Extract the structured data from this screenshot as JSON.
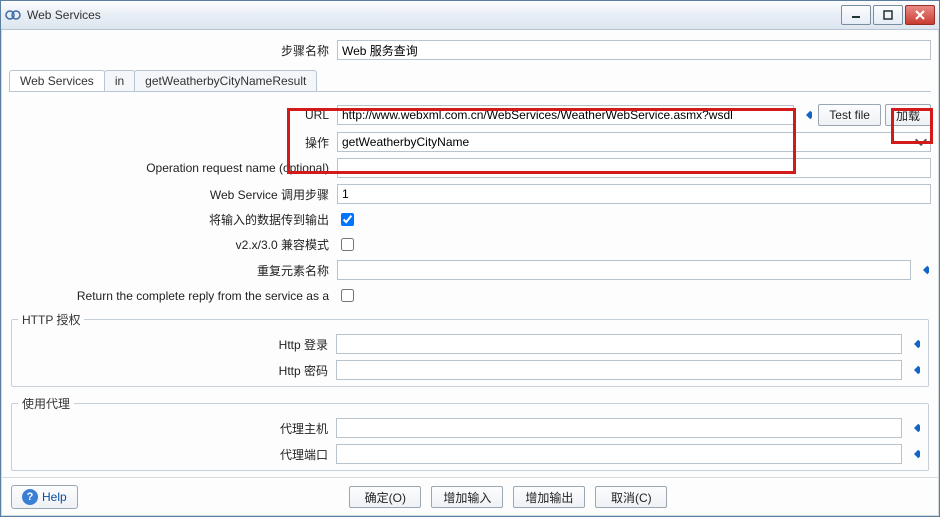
{
  "window": {
    "title": "Web Services",
    "min_tooltip": "Minimize",
    "max_tooltip": "Maximize",
    "close_tooltip": "Close"
  },
  "top": {
    "step_name_label": "步骤名称",
    "step_name_value": "Web 服务查询"
  },
  "tabs": {
    "tab1": "Web Services",
    "tab2": "in",
    "tab3": "getWeatherbyCityNameResult"
  },
  "form": {
    "url_label": "URL",
    "url_value": "http://www.webxml.com.cn/WebServices/WeatherWebService.asmx?wsdl",
    "test_file_btn": "Test file",
    "load_btn": "加载",
    "operation_label": "操作",
    "operation_value": "getWeatherbyCityName",
    "op_req_label": "Operation request name (optional)",
    "op_req_value": "",
    "call_steps_label": "Web Service 调用步骤",
    "call_steps_value": "1",
    "pass_output_label": "将输入的数据传到输出",
    "pass_output_checked": true,
    "compat_label": "v2.x/3.0 兼容模式",
    "compat_checked": false,
    "repeat_elem_label": "重复元素名称",
    "repeat_elem_value": "",
    "return_complete_label": "Return the complete reply from the service as a",
    "return_complete_checked": false
  },
  "http_auth": {
    "legend": "HTTP 授权",
    "login_label": "Http 登录",
    "login_value": "",
    "password_label": "Http 密码",
    "password_value": ""
  },
  "proxy": {
    "legend": "使用代理",
    "host_label": "代理主机",
    "host_value": "",
    "port_label": "代理端口",
    "port_value": ""
  },
  "buttons": {
    "help": "Help",
    "ok": "确定(O)",
    "add_input": "增加输入",
    "add_output": "增加输出",
    "cancel": "取消(C)"
  }
}
